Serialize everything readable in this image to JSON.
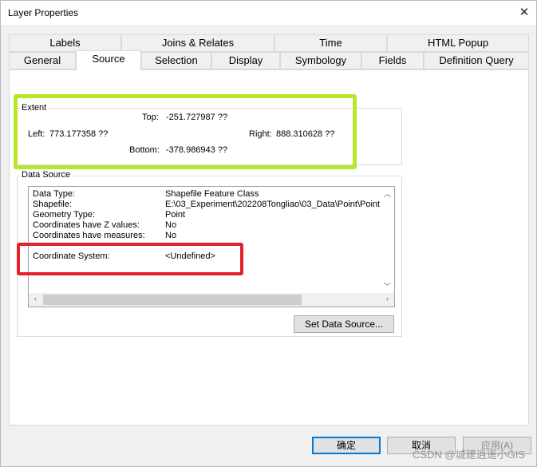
{
  "window": {
    "title": "Layer Properties",
    "close_glyph": "✕"
  },
  "tabs_row1": [
    "Labels",
    "Joins & Relates",
    "Time",
    "HTML Popup"
  ],
  "tabs_row2": [
    "General",
    "Source",
    "Selection",
    "Display",
    "Symbology",
    "Fields",
    "Definition Query"
  ],
  "active_tab": "Source",
  "extent": {
    "label": "Extent",
    "top_label": "Top:",
    "top_value": "-251.727987 ??",
    "left_label": "Left:",
    "left_value": "773.177358 ??",
    "right_label": "Right:",
    "right_value": "888.310628 ??",
    "bottom_label": "Bottom:",
    "bottom_value": "-378.986943 ??"
  },
  "data_source": {
    "label": "Data Source",
    "rows": [
      {
        "key": "Data Type:",
        "value": "Shapefile Feature Class"
      },
      {
        "key": "Shapefile:",
        "value": "E:\\03_Experiment\\202208Tongliao\\03_Data\\Point\\Point"
      },
      {
        "key": "Geometry Type:",
        "value": "Point"
      },
      {
        "key": "Coordinates have Z values:",
        "value": "No"
      },
      {
        "key": "Coordinates have measures:",
        "value": "No"
      },
      {
        "key": "Coordinate System:",
        "value": "<Undefined>"
      }
    ],
    "set_button": "Set Data Source..."
  },
  "footer": {
    "ok_label": "确定",
    "cancel_label": "取消",
    "apply_label": "应用(A)"
  },
  "watermark": "CSDN @城建逍遥小GIS",
  "colors": {
    "highlight_green": "#b8e62a",
    "highlight_red": "#e5202b",
    "primary_border": "#0078d7"
  }
}
